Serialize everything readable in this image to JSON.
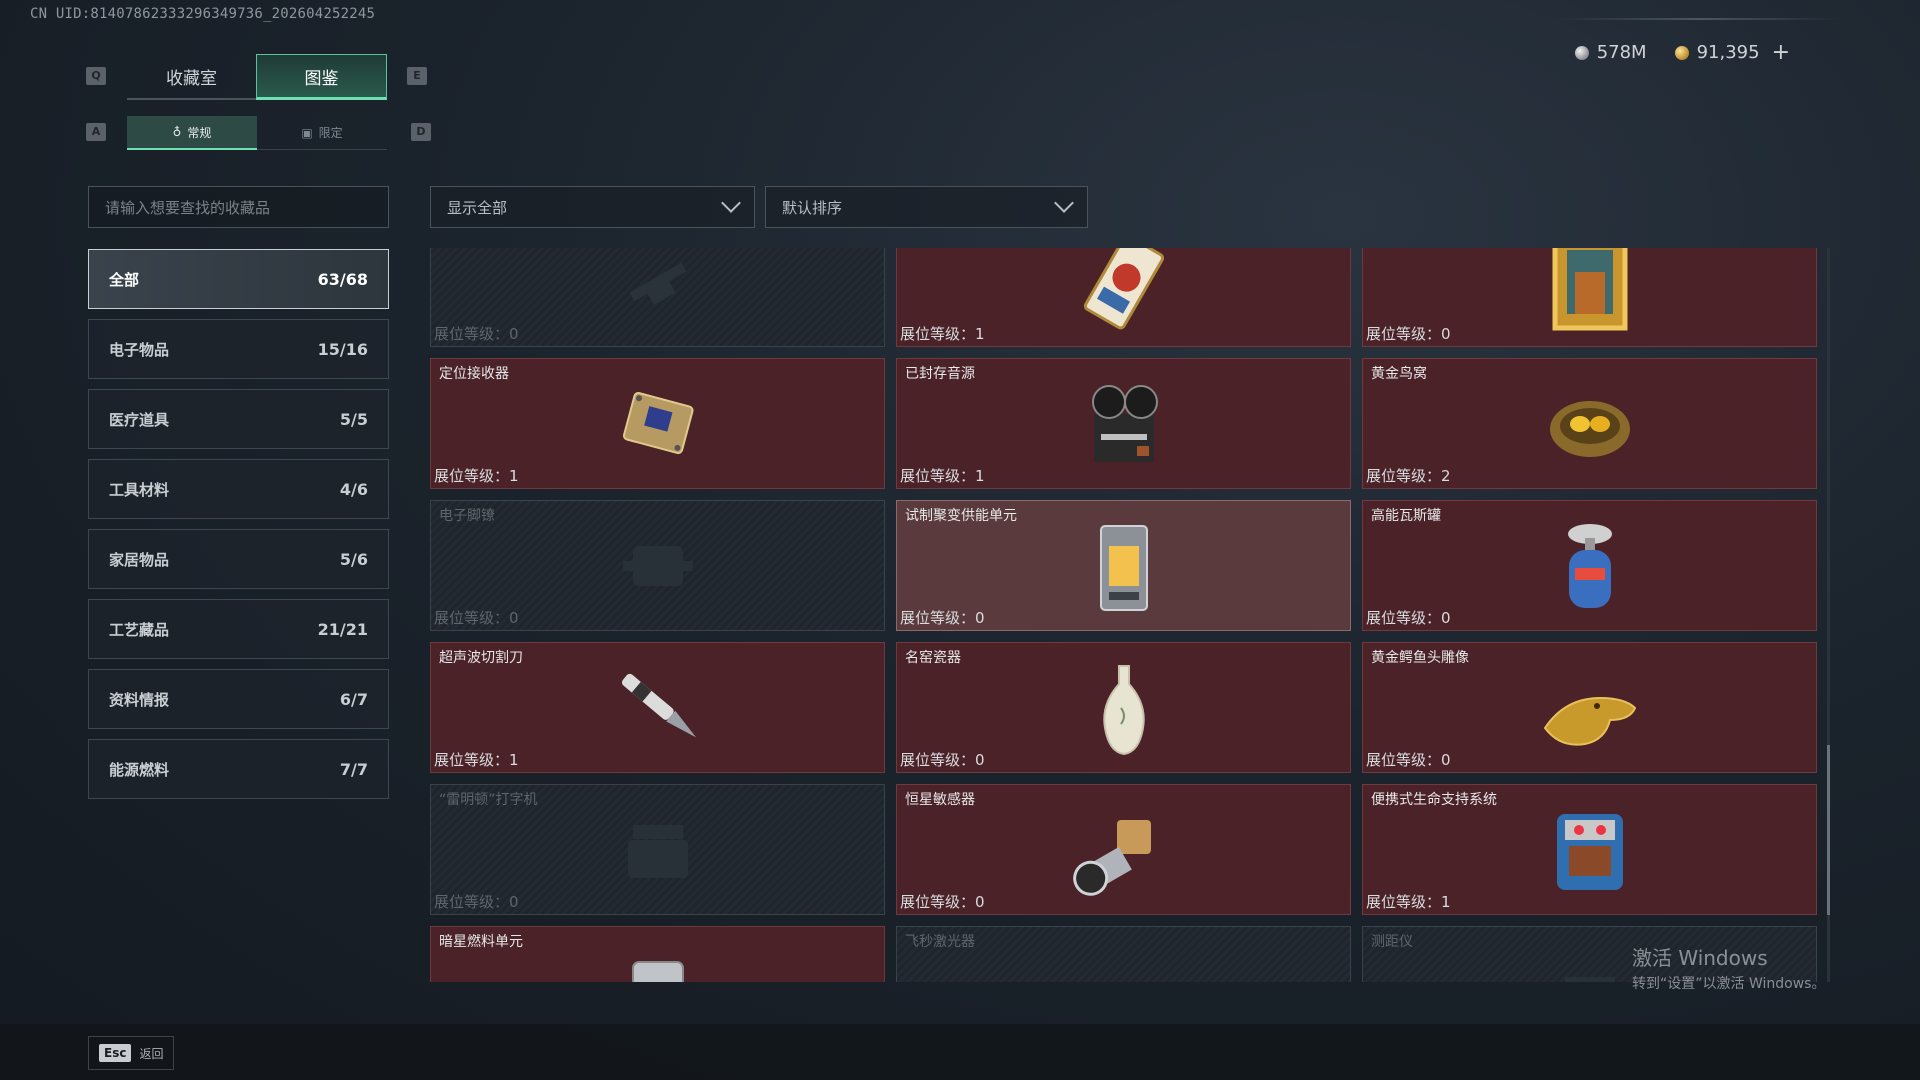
{
  "uid_text": "CN UID:8140786233329634973​6_202604252245",
  "currency": {
    "silver": "578M",
    "gold": "91,395",
    "add": "+"
  },
  "keys": {
    "prev_tab": "Q",
    "next_tab": "E",
    "prev_sub": "A",
    "next_sub": "D"
  },
  "tabs": [
    {
      "label": "收藏室"
    },
    {
      "label": "图鉴"
    }
  ],
  "subtabs": [
    {
      "label": "常规"
    },
    {
      "label": "限定"
    }
  ],
  "search": {
    "placeholder": "请输入想要查找的收藏品"
  },
  "filter": {
    "value": "显示全部"
  },
  "sort": {
    "value": "默认排序"
  },
  "categories": [
    {
      "label": "全部",
      "count": "63/68"
    },
    {
      "label": "电子物品",
      "count": "15/16"
    },
    {
      "label": "医疗道具",
      "count": "5/5"
    },
    {
      "label": "工具材料",
      "count": "4/6"
    },
    {
      "label": "家居物品",
      "count": "5/6"
    },
    {
      "label": "工艺藏品",
      "count": "21/21"
    },
    {
      "label": "资料情报",
      "count": "6/7"
    },
    {
      "label": "能源燃料",
      "count": "7/7"
    }
  ],
  "level_label": "展位等级：",
  "items": [
    {
      "name": "",
      "level": "0",
      "locked": true,
      "icon": "rifle-silhouette-icon"
    },
    {
      "name": "",
      "level": "1",
      "locked": false,
      "icon": "tarot-card-icon"
    },
    {
      "name": "",
      "level": "0",
      "locked": false,
      "icon": "gold-frame-painting-icon"
    },
    {
      "name": "定位接收器",
      "level": "1",
      "locked": false,
      "icon": "positioning-receiver-icon"
    },
    {
      "name": "已封存音源",
      "level": "1",
      "locked": false,
      "icon": "reel-recorder-icon"
    },
    {
      "name": "黄金鸟窝",
      "level": "2",
      "locked": false,
      "icon": "golden-nest-icon"
    },
    {
      "name": "电子脚镣",
      "level": "0",
      "locked": true,
      "icon": "ankle-monitor-icon"
    },
    {
      "name": "试制聚变供能单元",
      "level": "0",
      "locked": false,
      "highlight": true,
      "icon": "fusion-unit-icon"
    },
    {
      "name": "高能瓦斯罐",
      "level": "0",
      "locked": false,
      "icon": "gas-canister-icon"
    },
    {
      "name": "超声波切割刀",
      "level": "1",
      "locked": false,
      "icon": "ultrasonic-cutter-icon"
    },
    {
      "name": "名窑瓷器",
      "level": "0",
      "locked": false,
      "icon": "porcelain-vase-icon"
    },
    {
      "name": "黄金鳄鱼头雕像",
      "level": "0",
      "locked": false,
      "icon": "gold-crocodile-icon"
    },
    {
      "name": "“雷明顿”打字机",
      "level": "0",
      "locked": true,
      "icon": "typewriter-icon"
    },
    {
      "name": "恒星敏感器",
      "level": "0",
      "locked": false,
      "icon": "star-sensor-icon"
    },
    {
      "name": "便携式生命支持系统",
      "level": "1",
      "locked": false,
      "icon": "life-support-icon"
    },
    {
      "name": "暗星燃料单元",
      "level": "",
      "locked": false,
      "icon": "fuel-unit-icon"
    },
    {
      "name": "飞秒激光器",
      "level": "",
      "locked": true,
      "icon": "laser-icon"
    },
    {
      "name": "测距仪",
      "level": "",
      "locked": true,
      "icon": "rangefinder-icon"
    }
  ],
  "esc": {
    "key": "Esc",
    "label": "返回"
  },
  "watermark": {
    "line1": "激活 Windows",
    "line2": "转到“设置”以激活 Windows。"
  }
}
